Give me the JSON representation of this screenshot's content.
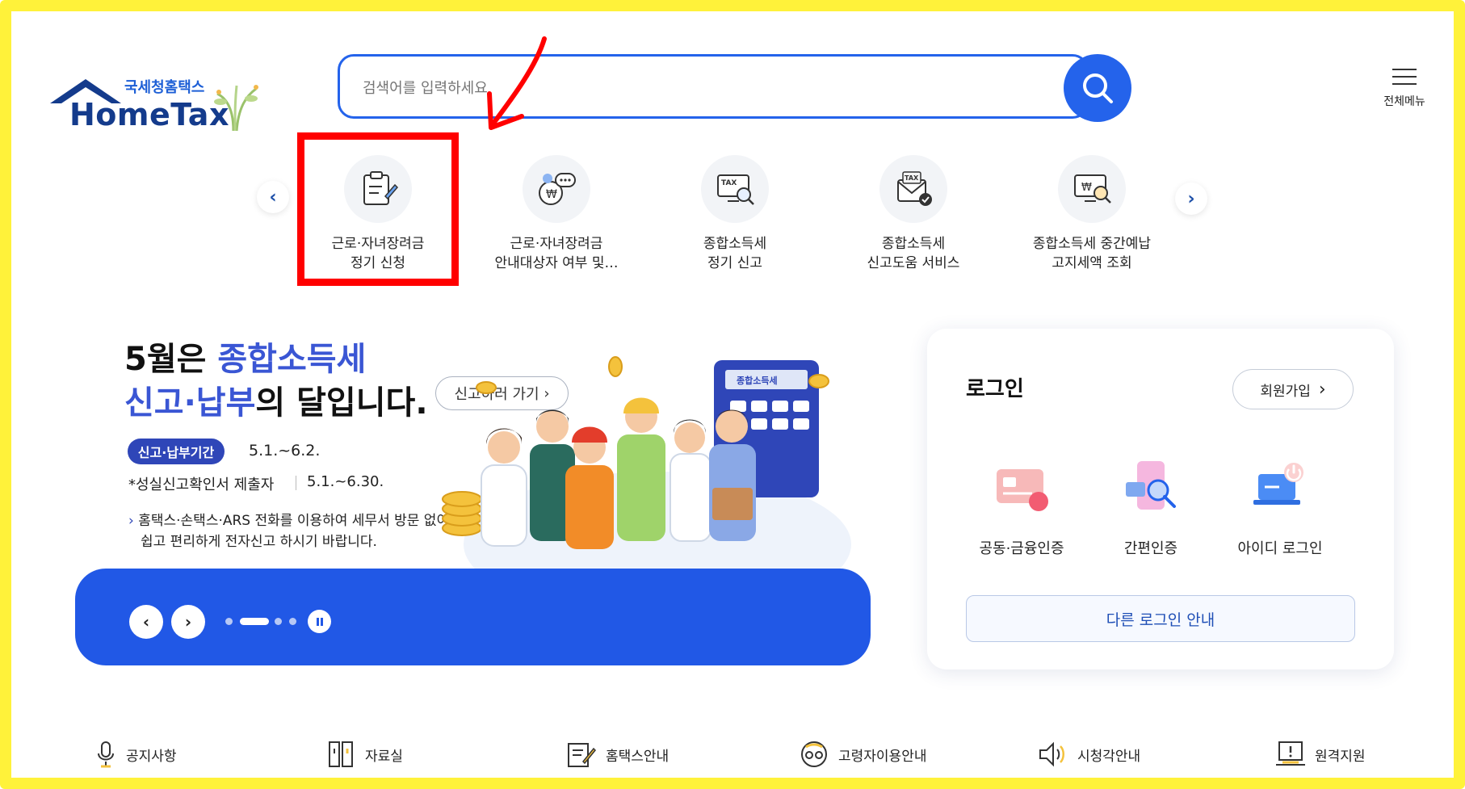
{
  "brand": {
    "korean_name": "국세청홈택스",
    "name": "HomeTax"
  },
  "search": {
    "placeholder": "검색어를 입력하세요"
  },
  "menu": {
    "label": "전체메뉴"
  },
  "quick_menu": [
    {
      "line1": "근로·자녀장려금",
      "line2": "정기 신청",
      "icon": "clipboard-pen-icon"
    },
    {
      "line1": "근로·자녀장려금",
      "line2": "안내대상자 여부 및…",
      "icon": "money-chat-icon"
    },
    {
      "line1": "종합소득세",
      "line2": "정기 신고",
      "icon": "tax-monitor-search-icon"
    },
    {
      "line1": "종합소득세",
      "line2": "신고도움 서비스",
      "icon": "tax-envelope-check-icon"
    },
    {
      "line1": "종합소득세 중간예납",
      "line2": "고지세액 조회",
      "icon": "money-monitor-search-icon"
    }
  ],
  "banner": {
    "title_line1_prefix": "5월은 ",
    "title_line1_highlight": "종합소득세",
    "title_line2_highlight": "신고·납부",
    "title_line2_suffix": "의 달입니다.",
    "cta_label": "신고하러 가기",
    "period_badge": "신고·납부기간",
    "period_value": "5.1.~6.2.",
    "sub_label": "성실신고확인서 제출자",
    "sub_value": "5.1.~6.30.",
    "note_line1": "홈택스·손택스·ARS 전화를 이용하여 세무서 방문 없이",
    "note_line2": "쉽고 편리하게 전자신고 하시기 바랍니다.",
    "calculator_label": "종합소득세"
  },
  "login": {
    "title": "로그인",
    "signup_label": "회원가입",
    "options": [
      {
        "label": "공동·금융인증",
        "icon": "certificate-card-icon"
      },
      {
        "label": "간편인증",
        "icon": "mobile-auth-icon"
      },
      {
        "label": "아이디 로그인",
        "icon": "laptop-power-icon"
      }
    ],
    "other_label": "다른 로그인 안내"
  },
  "footer_links": [
    {
      "label": "공지사항",
      "icon": "microphone-icon"
    },
    {
      "label": "자료실",
      "icon": "archive-icon"
    },
    {
      "label": "홈택스안내",
      "icon": "document-edit-icon"
    },
    {
      "label": "고령자이용안내",
      "icon": "elderly-glasses-icon"
    },
    {
      "label": "시청각안내",
      "icon": "speaker-icon"
    },
    {
      "label": "원격지원",
      "icon": "remote-support-icon"
    }
  ],
  "colors": {
    "primary": "#2463eb",
    "banner_bar": "#2158e6",
    "highlight": "#3a56d4",
    "annotation_red": "#ff0000",
    "frame_yellow": "#fff23a"
  }
}
